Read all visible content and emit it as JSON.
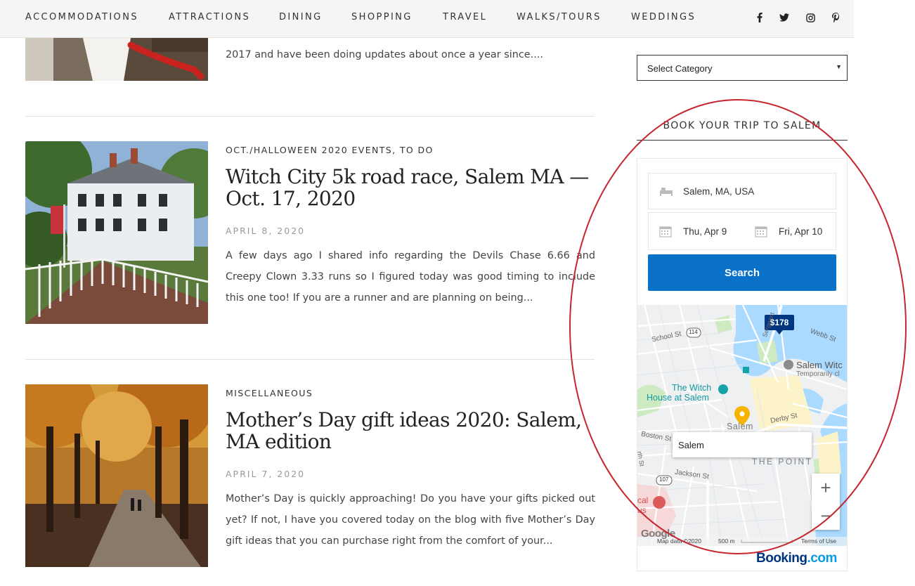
{
  "nav": {
    "items": [
      "Accommodations",
      "Attractions",
      "Dining",
      "Shopping",
      "Travel",
      "Walks/Tours",
      "Weddings"
    ],
    "social_icons": [
      "facebook-icon",
      "twitter-icon",
      "instagram-icon",
      "pinterest-icon"
    ]
  },
  "posts": [
    {
      "excerpt_fragment": "2017 and have been doing updates about once a year since...."
    },
    {
      "category_1": "Oct./Halloween 2020 Events",
      "category_sep": ",",
      "category_2": "To Do",
      "title": "Witch City 5k road race, Salem MA — Oct. 17, 2020",
      "date": "April 8, 2020",
      "excerpt": "A few days ago I shared info regarding the Devils Chase 6.66 and Creepy Clown 3.33 runs so I figured today was good timing to include this one too! If you are a runner and are planning on being..."
    },
    {
      "category_1": "Miscellaneous",
      "title": "Mother’s Day gift ideas 2020: Salem, MA edition",
      "date": "April 7, 2020",
      "excerpt": "Mother’s Day is quickly approaching! Do you have your gifts picked out yet? If not, I have you covered today on the blog with five Mother’s Day gift ideas that you can purchase right from the comfort of your..."
    }
  ],
  "sidebar": {
    "select_category": "Select Category",
    "select_arrow": "▼",
    "widget_title": "Book your trip to Salem",
    "destination": "Salem, MA, USA",
    "checkin": "Thu, Apr 9",
    "checkout": "Fri, Apr 10",
    "search_label": "Search"
  },
  "map": {
    "price_tag": "$178",
    "search_box_value": "Salem",
    "labels": {
      "school_st": "School St",
      "route_114": "114",
      "sergeant": "Sergeant",
      "webb_st": "Webb St",
      "salem_witch": "Salem Witc",
      "temp_closed": "Temporarily cl",
      "witch_house_1": "The Witch",
      "witch_house_2": "House at Salem",
      "salem": "Salem",
      "derby_st": "Derby St",
      "boston_st": "Boston St",
      "the_point": "THE POINT",
      "jackson_st": "Jackson St",
      "route_107": "107",
      "cal_1": "cal",
      "cal_2": "us",
      "north_st": "rth St"
    },
    "zoom_in": "+",
    "zoom_out": "−",
    "google": "Google",
    "map_data": "Map data ©2020",
    "scale": "500 m",
    "terms": "Terms of Use"
  },
  "booking_logo": {
    "part1": "Booking",
    "part2": ".com"
  },
  "colors": {
    "primary_button": "#0a71c9",
    "annotation": "#c6262e",
    "price_tag": "#003580"
  }
}
